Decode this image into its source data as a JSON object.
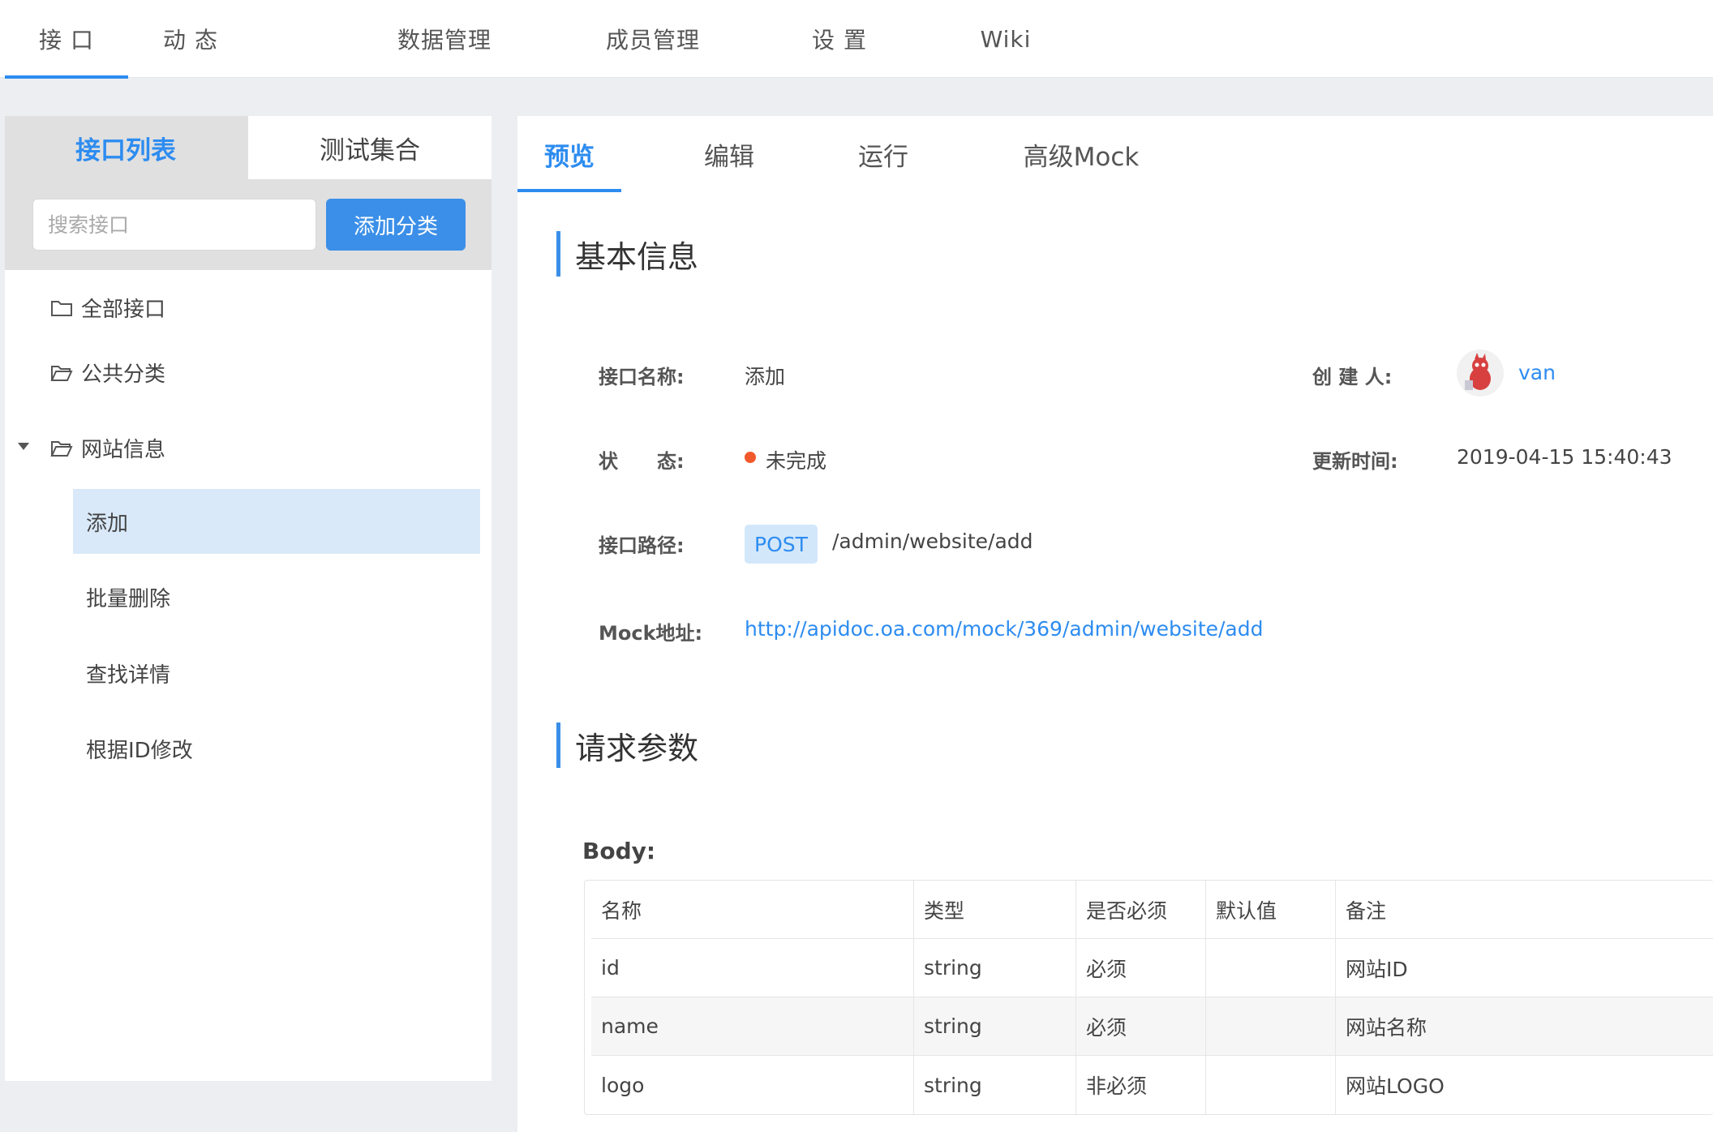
{
  "topnav": {
    "tabs": [
      {
        "label": "接 口",
        "active": true
      },
      {
        "label": "动 态",
        "active": false
      },
      {
        "label": "数据管理",
        "active": false
      },
      {
        "label": "成员管理",
        "active": false
      },
      {
        "label": "设 置",
        "active": false
      },
      {
        "label": "Wiki",
        "active": false
      }
    ]
  },
  "sidebar": {
    "tabs": [
      "接口列表",
      "测试集合"
    ],
    "search_placeholder": "搜索接口",
    "add_category_label": "添加分类",
    "tree": {
      "all": "全部接口",
      "public": "公共分类",
      "website": "网站信息"
    },
    "leaves": [
      "添加",
      "批量删除",
      "查找详情",
      "根据ID修改"
    ],
    "active_leaf": "添加"
  },
  "main": {
    "tabs": [
      "预览",
      "编辑",
      "运行",
      "高级Mock"
    ],
    "active_tab": "预览",
    "basic_info_title": "基本信息",
    "request_params_title": "请求参数",
    "info": {
      "name_label": "接口名称:",
      "name_value": "添加",
      "creator_label": "创 建 人:",
      "creator_value": "van",
      "status_label": "状　　态:",
      "status_value": "未完成",
      "updated_label": "更新时间:",
      "updated_value": "2019-04-15 15:40:43",
      "path_label": "接口路径:",
      "method": "POST",
      "path_value": "/admin/website/add",
      "mock_label": "Mock地址:",
      "mock_value": "http://apidoc.oa.com/mock/369/admin/website/add"
    },
    "body_label": "Body:",
    "table": {
      "headers": [
        "名称",
        "类型",
        "是否必须",
        "默认值",
        "备注"
      ],
      "rows": [
        [
          "id",
          "string",
          "必须",
          "",
          "网站ID"
        ],
        [
          "name",
          "string",
          "必须",
          "",
          "网站名称"
        ],
        [
          "logo",
          "string",
          "非必须",
          "",
          "网站LOGO"
        ]
      ]
    }
  },
  "colors": {
    "accent": "#2d8cf0",
    "button": "#3b8fe8",
    "status_dot": "#f1592a",
    "active_leaf_bg": "#d9e9f9"
  }
}
